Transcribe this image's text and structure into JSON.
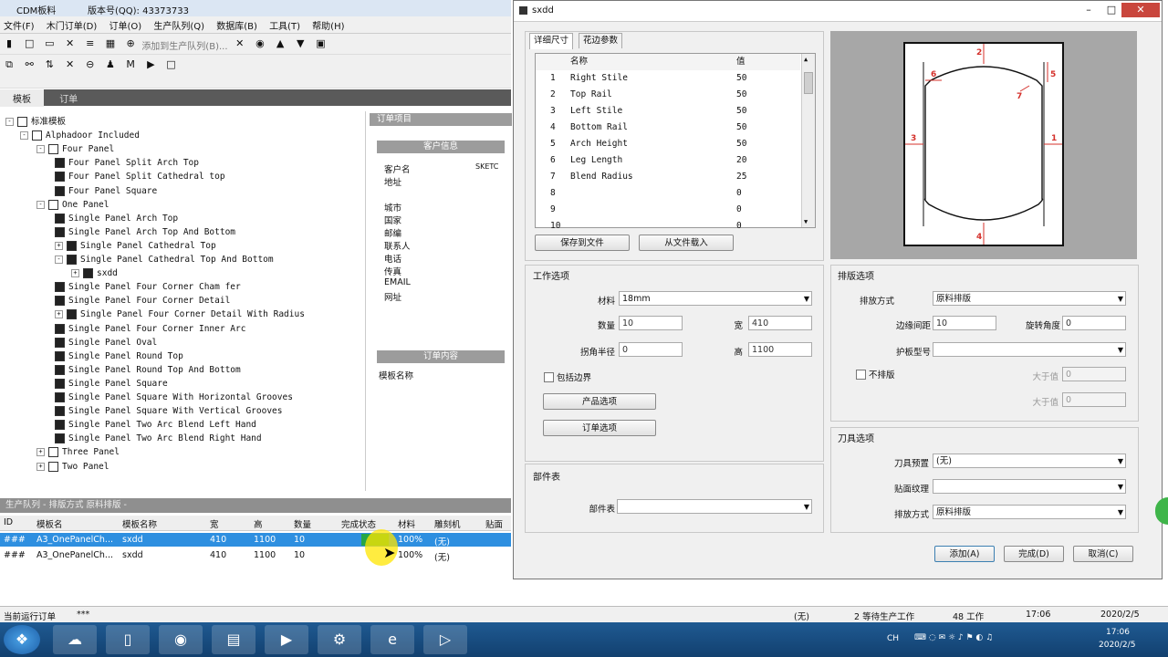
{
  "app": {
    "title": "CDM板料",
    "subtitle": "版本号(QQ): 43373733",
    "menu": [
      "文件(F)",
      "木门订单(D)",
      "订单(O)",
      "生产队列(Q)",
      "数据库(B)",
      "工具(T)",
      "帮助(H)"
    ],
    "toolbar_text": "添加到生产队列(B)...",
    "tabs": [
      "模板",
      "订单"
    ],
    "tree": [
      {
        "label": "标准模板",
        "level": 0,
        "exp": "-"
      },
      {
        "label": "Alphadoor Included",
        "level": 1,
        "exp": "-"
      },
      {
        "label": "Four Panel",
        "level": 2,
        "exp": "-"
      },
      {
        "label": "Four Panel Split Arch Top",
        "level": 3
      },
      {
        "label": "Four Panel Split Cathedral top",
        "level": 3
      },
      {
        "label": "Four Panel Square",
        "level": 3
      },
      {
        "label": "One Panel",
        "level": 2,
        "exp": "-"
      },
      {
        "label": "Single Panel Arch Top",
        "level": 3
      },
      {
        "label": "Single Panel Arch Top And Bottom",
        "level": 3
      },
      {
        "label": "Single Panel Cathedral Top",
        "level": 3,
        "exp": "+"
      },
      {
        "label": "Single Panel Cathedral Top And Bottom",
        "level": 3,
        "exp": "-"
      },
      {
        "label": "sxdd",
        "level": 4,
        "exp": "+"
      },
      {
        "label": "Single Panel Four Corner Cham fer",
        "level": 3
      },
      {
        "label": "Single Panel Four Corner Detail",
        "level": 3
      },
      {
        "label": "Single Panel Four Corner Detail With Radius",
        "level": 3,
        "exp": "+"
      },
      {
        "label": "Single Panel Four Corner Inner Arc",
        "level": 3
      },
      {
        "label": "Single Panel Oval",
        "level": 3
      },
      {
        "label": "Single Panel Round Top",
        "level": 3
      },
      {
        "label": "Single Panel Round Top And Bottom",
        "level": 3
      },
      {
        "label": "Single Panel Square",
        "level": 3
      },
      {
        "label": "Single Panel Square With Horizontal Grooves",
        "level": 3
      },
      {
        "label": "Single Panel Square With Vertical Grooves",
        "level": 3
      },
      {
        "label": "Single Panel Two Arc Blend Left Hand",
        "level": 3
      },
      {
        "label": "Single Panel Two Arc Blend Right Hand",
        "level": 3
      },
      {
        "label": "Three Panel",
        "level": 2,
        "exp": "+"
      },
      {
        "label": "Two Panel",
        "level": 2,
        "exp": "+"
      }
    ],
    "info": {
      "header": "订单项目",
      "sub_header": "客户信息",
      "labels": [
        "客户名",
        "地址",
        "城市",
        "国家",
        "邮编",
        "联系人",
        "电话",
        "传真",
        "EMAIL",
        "网址"
      ],
      "customer_value": "SKETC",
      "note_header": "订单内容",
      "note_label": "模板名称"
    },
    "bottom_title": "生产队列 - 排版方式 原料排版 -",
    "grid_headers": [
      "ID",
      "模板名",
      "模板名称",
      "宽",
      "高",
      "数量",
      "完成状态",
      "材料",
      "雕刻机",
      "贴面"
    ],
    "grid_rows": [
      [
        "###",
        "A3_OnePanelCh...",
        "sxdd",
        "410",
        "1100",
        "10",
        "",
        "100%",
        "(无)",
        ""
      ],
      [
        "###",
        "A3_OnePanelCh...",
        "sxdd",
        "410",
        "1100",
        "10",
        "",
        "100%",
        "(无)",
        ""
      ]
    ],
    "status": {
      "left": "当前运行订单",
      "left_val": "***",
      "mid1": "(无)",
      "mid2": "2 等待生产工作",
      "mid3": "48 工作",
      "mid4": "17:06",
      "mid5": "2020/2/5"
    }
  },
  "dialog": {
    "title": "sxdd",
    "tabs": [
      "详细尺寸",
      "花边参数"
    ],
    "list_headers": [
      "名称",
      "值"
    ],
    "params": [
      {
        "n": "1",
        "name": "Right Stile",
        "value": "50"
      },
      {
        "n": "2",
        "name": "Top Rail",
        "value": "50"
      },
      {
        "n": "3",
        "name": "Left Stile",
        "value": "50"
      },
      {
        "n": "4",
        "name": "Bottom Rail",
        "value": "50"
      },
      {
        "n": "5",
        "name": "Arch Height",
        "value": "50"
      },
      {
        "n": "6",
        "name": "Leg Length",
        "value": "20"
      },
      {
        "n": "7",
        "name": "Blend Radius",
        "value": "25"
      },
      {
        "n": "8",
        "name": "",
        "value": "0"
      },
      {
        "n": "9",
        "name": "",
        "value": "0"
      },
      {
        "n": "10",
        "name": "",
        "value": "0"
      }
    ],
    "btn_save_file": "保存到文件",
    "btn_load_file": "从文件载入",
    "work": {
      "title": "工作选项",
      "material_label": "材料",
      "material_value": "18mm",
      "qty_label": "数量",
      "qty_value": "10",
      "width_label": "宽",
      "width_value": "410",
      "radius_label": "拐角半径",
      "radius_value": "0",
      "height_label": "高",
      "height_value": "1100",
      "check_label": "包括边界",
      "btn_product": "产品选项",
      "btn_order": "订单选项"
    },
    "part": {
      "title": "部件表",
      "label": "部件表",
      "value": ""
    },
    "pattern": {
      "title": "排版选项",
      "method_label": "排放方式",
      "method_value": "原料排版",
      "spacing_label": "边缘间距",
      "spacing_value": "10",
      "rotate_label": "旋转角度",
      "rotate_value": "0",
      "sheet_label": "护板型号",
      "sheet_value": "",
      "nocheck_label": "不排版",
      "gt_label": "大于值",
      "gt_value": "0",
      "lt_label": "大于值",
      "lt_value": "0"
    },
    "cut": {
      "title": "刀具选项",
      "tool1_label": "刀具预置",
      "tool1_value": "(无)",
      "tool2_label": "贴面纹理",
      "tool2_value": "",
      "tool3_label": "排放方式",
      "tool3_value": "原料排版"
    },
    "btn_add": "添加(A)",
    "btn_done": "完成(D)",
    "btn_cancel": "取消(C)",
    "preview_labels": [
      "1",
      "2",
      "3",
      "4",
      "5",
      "6",
      "7"
    ]
  },
  "taskbar": {
    "tray_lang": "CH",
    "clock_time": "17:06",
    "clock_date": "2020/2/5"
  },
  "colors": {
    "selection": "#2e8fe0",
    "taskbar": "#1f5a92",
    "dim_red": "#d4302b"
  }
}
